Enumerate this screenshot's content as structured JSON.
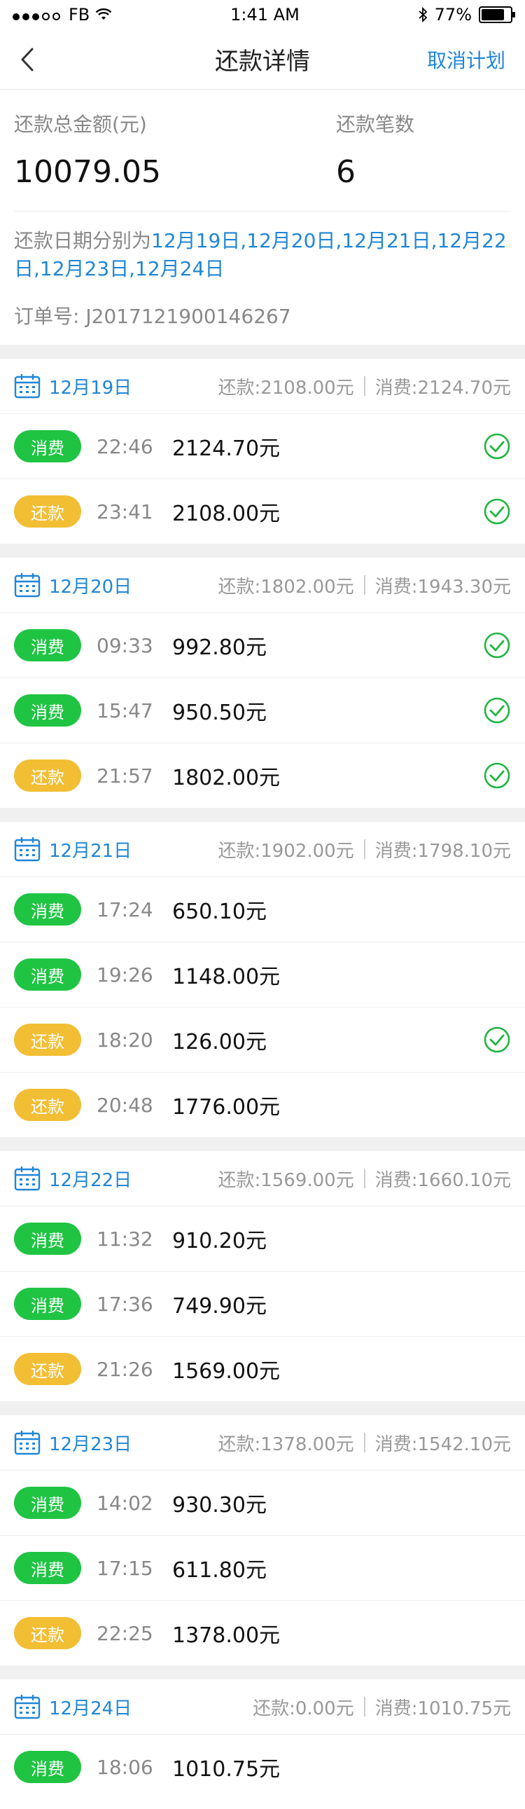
{
  "status_bar": {
    "carrier": "FB",
    "time": "1:41 AM",
    "battery": "77%"
  },
  "nav": {
    "title": "还款详情",
    "action": "取消计划"
  },
  "summary": {
    "total_label": "还款总金额(元)",
    "total_value": "10079.05",
    "count_label": "还款笔数",
    "count_value": "6",
    "dates_prefix": "还款日期分别为",
    "dates_list": "12月19日,12月20日,12月21日,12月22日,12月23日,12月24日",
    "order_label": "订单号:",
    "order_number": "J2017121900146267"
  },
  "days": [
    {
      "date": "12月19日",
      "repay": "还款:2108.00元",
      "spend": "消费:2124.70元",
      "rows": [
        {
          "type": "消费",
          "kind": "spend",
          "time": "22:46",
          "amount": "2124.70元",
          "done": true
        },
        {
          "type": "还款",
          "kind": "repay",
          "time": "23:41",
          "amount": "2108.00元",
          "done": true
        }
      ]
    },
    {
      "date": "12月20日",
      "repay": "还款:1802.00元",
      "spend": "消费:1943.30元",
      "rows": [
        {
          "type": "消费",
          "kind": "spend",
          "time": "09:33",
          "amount": "992.80元",
          "done": true
        },
        {
          "type": "消费",
          "kind": "spend",
          "time": "15:47",
          "amount": "950.50元",
          "done": true
        },
        {
          "type": "还款",
          "kind": "repay",
          "time": "21:57",
          "amount": "1802.00元",
          "done": true
        }
      ]
    },
    {
      "date": "12月21日",
      "repay": "还款:1902.00元",
      "spend": "消费:1798.10元",
      "rows": [
        {
          "type": "消费",
          "kind": "spend",
          "time": "17:24",
          "amount": "650.10元",
          "done": false
        },
        {
          "type": "消费",
          "kind": "spend",
          "time": "19:26",
          "amount": "1148.00元",
          "done": false
        },
        {
          "type": "还款",
          "kind": "repay",
          "time": "18:20",
          "amount": "126.00元",
          "done": true
        },
        {
          "type": "还款",
          "kind": "repay",
          "time": "20:48",
          "amount": "1776.00元",
          "done": false
        }
      ]
    },
    {
      "date": "12月22日",
      "repay": "还款:1569.00元",
      "spend": "消费:1660.10元",
      "rows": [
        {
          "type": "消费",
          "kind": "spend",
          "time": "11:32",
          "amount": "910.20元",
          "done": false
        },
        {
          "type": "消费",
          "kind": "spend",
          "time": "17:36",
          "amount": "749.90元",
          "done": false
        },
        {
          "type": "还款",
          "kind": "repay",
          "time": "21:26",
          "amount": "1569.00元",
          "done": false
        }
      ]
    },
    {
      "date": "12月23日",
      "repay": "还款:1378.00元",
      "spend": "消费:1542.10元",
      "rows": [
        {
          "type": "消费",
          "kind": "spend",
          "time": "14:02",
          "amount": "930.30元",
          "done": false
        },
        {
          "type": "消费",
          "kind": "spend",
          "time": "17:15",
          "amount": "611.80元",
          "done": false
        },
        {
          "type": "还款",
          "kind": "repay",
          "time": "22:25",
          "amount": "1378.00元",
          "done": false
        }
      ]
    },
    {
      "date": "12月24日",
      "repay": "还款:0.00元",
      "spend": "消费:1010.75元",
      "rows": [
        {
          "type": "消费",
          "kind": "spend",
          "time": "18:06",
          "amount": "1010.75元",
          "done": false
        }
      ]
    }
  ],
  "colors": {
    "accent_blue": "#1f86d6",
    "spend_green": "#1fc443",
    "repay_yellow": "#f2be34",
    "check_green": "#1fb53f"
  }
}
